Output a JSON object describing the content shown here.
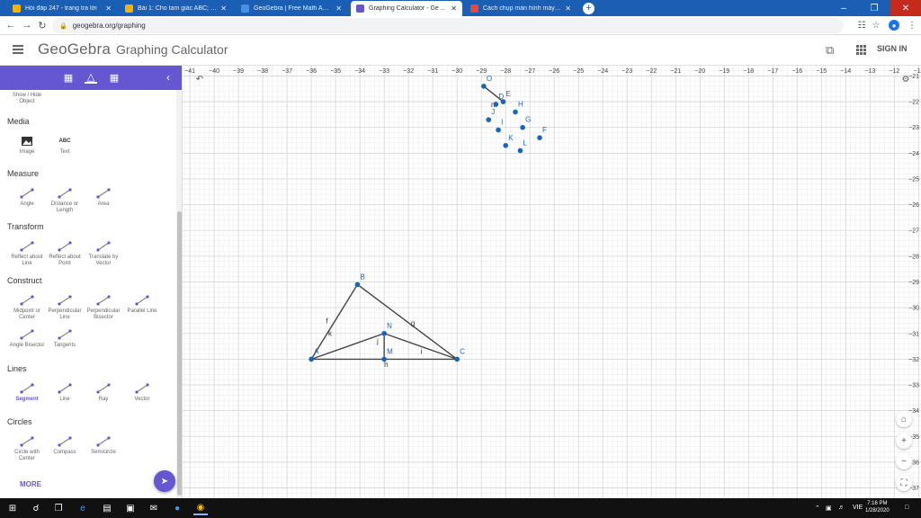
{
  "browser": {
    "tabs": [
      {
        "title": "Hỏi đáp 247 - trang tra lời",
        "active": false,
        "favicon_color": "#f4b400"
      },
      {
        "title": "Bài 1: Cho tam giác ABC; M là tru",
        "active": false,
        "favicon_color": "#f4b400"
      },
      {
        "title": "GeoGebra | Free Math Apps - us",
        "active": false,
        "favicon_color": "#4a90e2"
      },
      {
        "title": "Graphing Calculator - GeoGebra",
        "active": true,
        "favicon_color": "#6557d2"
      },
      {
        "title": "Cách chụp màn hình máy tính nh",
        "active": false,
        "favicon_color": "#e8453c"
      }
    ],
    "url": "geogebra.org/graphing"
  },
  "app": {
    "logo": "GeoGebra",
    "title": "Graphing Calculator",
    "signin": "SIGN IN",
    "accent": "#6557d2"
  },
  "sidebar": {
    "show_hide": "Show / Hide Object",
    "sections": [
      {
        "title": "Media",
        "tools": [
          {
            "label": "Image",
            "icon": "image-icon"
          },
          {
            "label": "Text",
            "icon": "text-icon",
            "glyph": "ABC"
          }
        ]
      },
      {
        "title": "Measure",
        "tools": [
          {
            "label": "Angle",
            "icon": "angle-icon"
          },
          {
            "label": "Distance or Length",
            "icon": "distance-icon"
          },
          {
            "label": "Area",
            "icon": "area-icon"
          }
        ]
      },
      {
        "title": "Transform",
        "tools": [
          {
            "label": "Reflect about Line",
            "icon": "reflect-line-icon"
          },
          {
            "label": "Reflect about Point",
            "icon": "reflect-point-icon"
          },
          {
            "label": "Translate by Vector",
            "icon": "translate-icon"
          }
        ]
      },
      {
        "title": "Construct",
        "tools": [
          {
            "label": "Midpoint or Center",
            "icon": "midpoint-icon"
          },
          {
            "label": "Perpendicular Line",
            "icon": "perpendicular-line-icon"
          },
          {
            "label": "Perpendicular Bisector",
            "icon": "perpendicular-bisector-icon"
          },
          {
            "label": "Parallel Line",
            "icon": "parallel-line-icon"
          },
          {
            "label": "Angle Bisector",
            "icon": "angle-bisector-icon"
          },
          {
            "label": "Tangents",
            "icon": "tangents-icon"
          }
        ]
      },
      {
        "title": "Lines",
        "tools": [
          {
            "label": "Segment",
            "icon": "segment-icon",
            "selected": true
          },
          {
            "label": "Line",
            "icon": "line-icon"
          },
          {
            "label": "Ray",
            "icon": "ray-icon"
          },
          {
            "label": "Vector",
            "icon": "vector-icon"
          }
        ]
      },
      {
        "title": "Circles",
        "tools": [
          {
            "label": "Circle with Center",
            "icon": "circle-center-icon"
          },
          {
            "label": "Compass",
            "icon": "compass-icon"
          },
          {
            "label": "Semicircle",
            "icon": "semicircle-icon"
          }
        ]
      }
    ],
    "more": "MORE"
  },
  "graph": {
    "x_range": [
      -41.3,
      -10.9
    ],
    "y_range": [
      -37.4,
      -20.6
    ],
    "x_ticks": [
      -41,
      -40,
      -39,
      -38,
      -37,
      -36,
      -35,
      -34,
      -33,
      -32,
      -31,
      -30,
      -29,
      -28,
      -27,
      -26,
      -25,
      -24,
      -23,
      -22,
      -21,
      -20,
      -19,
      -18,
      -17,
      -16,
      -15,
      -14,
      -13,
      -12,
      -11
    ],
    "y_ticks": [
      -21,
      -22,
      -23,
      -24,
      -25,
      -26,
      -27,
      -28,
      -29,
      -30,
      -31,
      -32,
      -33,
      -34,
      -35,
      -36,
      -37
    ],
    "point_color": "#1565c0",
    "segment_color": "#444444",
    "points": [
      {
        "name": "A",
        "x": -36,
        "y": -32
      },
      {
        "name": "B",
        "x": -34.1,
        "y": -29.1
      },
      {
        "name": "C",
        "x": -30,
        "y": -32
      },
      {
        "name": "N",
        "x": -33,
        "y": -31
      },
      {
        "name": "M",
        "x": -33,
        "y": -32
      },
      {
        "name": "O",
        "x": -28.9,
        "y": -21.4
      },
      {
        "name": "D",
        "x": -28.4,
        "y": -22.1
      },
      {
        "name": "E",
        "x": -28.1,
        "y": -22
      },
      {
        "name": "H",
        "x": -27.6,
        "y": -22.4
      },
      {
        "name": "J",
        "x": -28.7,
        "y": -22.7
      },
      {
        "name": "I",
        "x": -28.3,
        "y": -23.1
      },
      {
        "name": "G",
        "x": -27.3,
        "y": -23
      },
      {
        "name": "F",
        "x": -26.6,
        "y": -23.4
      },
      {
        "name": "K",
        "x": -28,
        "y": -23.7
      },
      {
        "name": "L",
        "x": -27.4,
        "y": -23.9
      }
    ],
    "segments": [
      {
        "name": "f",
        "from": "A",
        "to": "B"
      },
      {
        "name": "g",
        "from": "B",
        "to": "C"
      },
      {
        "name": "h",
        "from": "A",
        "to": "C"
      },
      {
        "name": "k",
        "from": "A",
        "to": "N"
      },
      {
        "name": "i",
        "from": "N",
        "to": "C"
      },
      {
        "name": "j",
        "from": "N",
        "to": "M"
      },
      {
        "name": "m",
        "from": "O",
        "to": "E"
      }
    ],
    "segment_labels": [
      {
        "name": "f",
        "x": -35.4,
        "y": -30.6
      },
      {
        "name": "k",
        "x": -35.3,
        "y": -31.1
      },
      {
        "name": "g",
        "x": -31.9,
        "y": -30.7
      },
      {
        "name": "j",
        "x": -33.3,
        "y": -31.4
      },
      {
        "name": "i",
        "x": -31.5,
        "y": -31.8
      },
      {
        "name": "h",
        "x": -33,
        "y": -32.3
      },
      {
        "name": "m",
        "x": -28.6,
        "y": -22.2
      }
    ]
  },
  "taskbar": {
    "time": "7:16 PM",
    "date": "1/28/2020",
    "lang": "VIE"
  }
}
